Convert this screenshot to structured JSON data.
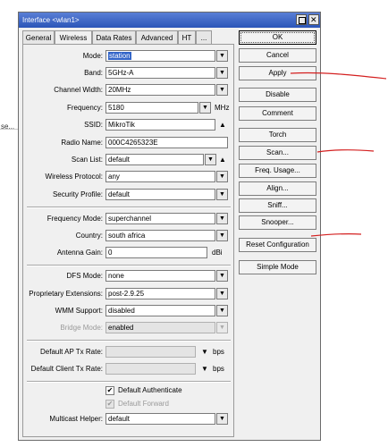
{
  "background": {
    "stub_text": "se..."
  },
  "window": {
    "title": "Interface <wlan1>",
    "titlebar_color": "#2b55b8",
    "restore_icon": "restore-icon",
    "close_icon": "close-icon"
  },
  "tabs": [
    {
      "label": "General",
      "active": false
    },
    {
      "label": "Wireless",
      "active": true
    },
    {
      "label": "Data Rates",
      "active": false
    },
    {
      "label": "Advanced",
      "active": false
    },
    {
      "label": "HT",
      "active": false
    },
    {
      "label": "...",
      "active": false
    }
  ],
  "fields": {
    "mode": {
      "label": "Mode:",
      "value": "station"
    },
    "band": {
      "label": "Band:",
      "value": "5GHz-A"
    },
    "channel_width": {
      "label": "Channel Width:",
      "value": "20MHz"
    },
    "frequency": {
      "label": "Frequency:",
      "value": "5180",
      "unit": "MHz"
    },
    "ssid": {
      "label": "SSID:",
      "value": "MikroTik"
    },
    "radio_name": {
      "label": "Radio Name:",
      "value": "000C4265323E"
    },
    "scan_list": {
      "label": "Scan List:",
      "value": "default"
    },
    "wireless_protocol": {
      "label": "Wireless Protocol:",
      "value": "any"
    },
    "security_profile": {
      "label": "Security Profile:",
      "value": "default"
    },
    "frequency_mode": {
      "label": "Frequency Mode:",
      "value": "superchannel"
    },
    "country": {
      "label": "Country:",
      "value": "south africa"
    },
    "antenna_gain": {
      "label": "Antenna Gain:",
      "value": "0",
      "unit": "dBi"
    },
    "dfs_mode": {
      "label": "DFS Mode:",
      "value": "none"
    },
    "proprietary_extensions": {
      "label": "Proprietary Extensions:",
      "value": "post-2.9.25"
    },
    "wmm_support": {
      "label": "WMM Support:",
      "value": "disabled"
    },
    "bridge_mode": {
      "label": "Bridge Mode:",
      "value": "enabled"
    },
    "default_ap_tx_rate": {
      "label": "Default AP Tx Rate:",
      "value": "",
      "unit": "bps"
    },
    "default_client_tx_rate": {
      "label": "Default Client Tx Rate:",
      "value": "",
      "unit": "bps"
    },
    "multicast_helper": {
      "label": "Multicast Helper:",
      "value": "default"
    }
  },
  "checkboxes": {
    "default_authenticate": {
      "label": "Default Authenticate",
      "checked": true
    },
    "default_forward": {
      "label": "Default Forward",
      "checked": true
    }
  },
  "buttons": {
    "ok": "OK",
    "cancel": "Cancel",
    "apply": "Apply",
    "disable": "Disable",
    "comment": "Comment",
    "torch": "Torch",
    "scan": "Scan...",
    "freq_usage": "Freq. Usage...",
    "align": "Align...",
    "sniff": "Sniff...",
    "snooper": "Snooper...",
    "reset_configuration": "Reset Configuration",
    "simple_mode": "Simple Mode"
  },
  "annotation_color": "#d42020"
}
